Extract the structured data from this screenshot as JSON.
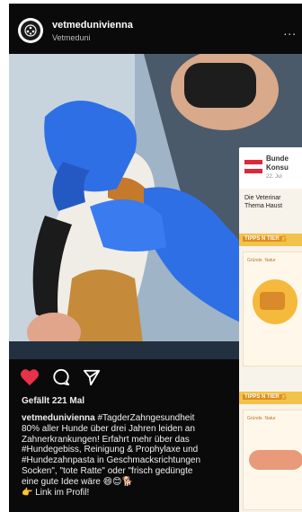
{
  "header": {
    "username": "vetmedunivienna",
    "subname": "Vetmeduni",
    "more": "..."
  },
  "poster": {
    "title_line1": "Bunde",
    "title_line2": "Konsu",
    "date": "22. Jul",
    "intro_line1": "Die Veterinar",
    "intro_line2": "Thema Haust",
    "tip_label": "TIPPS N TIER",
    "tip_g": "G",
    "card_text": "Gründe. Natur",
    "colors": {
      "accent": "#f2c34a",
      "dark_accent": "#e08e1c"
    }
  },
  "post": {
    "likes": "Gefällt 221 Mal",
    "username": "vetmedunivienna",
    "caption_lines": [
      " #TagderZahngesundheit",
      "80% aller Hunde über drei Jahren leiden an",
      "Zahnerkrankungen! Erfahrt mehr über das",
      "#Hundegebiss, Reinigung & Prophylaxe und",
      "#Hundezahnpasta in Geschmacksrichtungen",
      "Socken\", \"tote Ratte\" oder \"frisch gedüngte",
      "eine gute Idee wäre 😄😊🐕",
      "👉 Link im Profil!"
    ]
  },
  "icons": {
    "like": "heart-icon",
    "comment": "comment-icon",
    "share": "send-icon"
  },
  "colors": {
    "like": "#e8324a",
    "background": "#0a0a0a"
  }
}
